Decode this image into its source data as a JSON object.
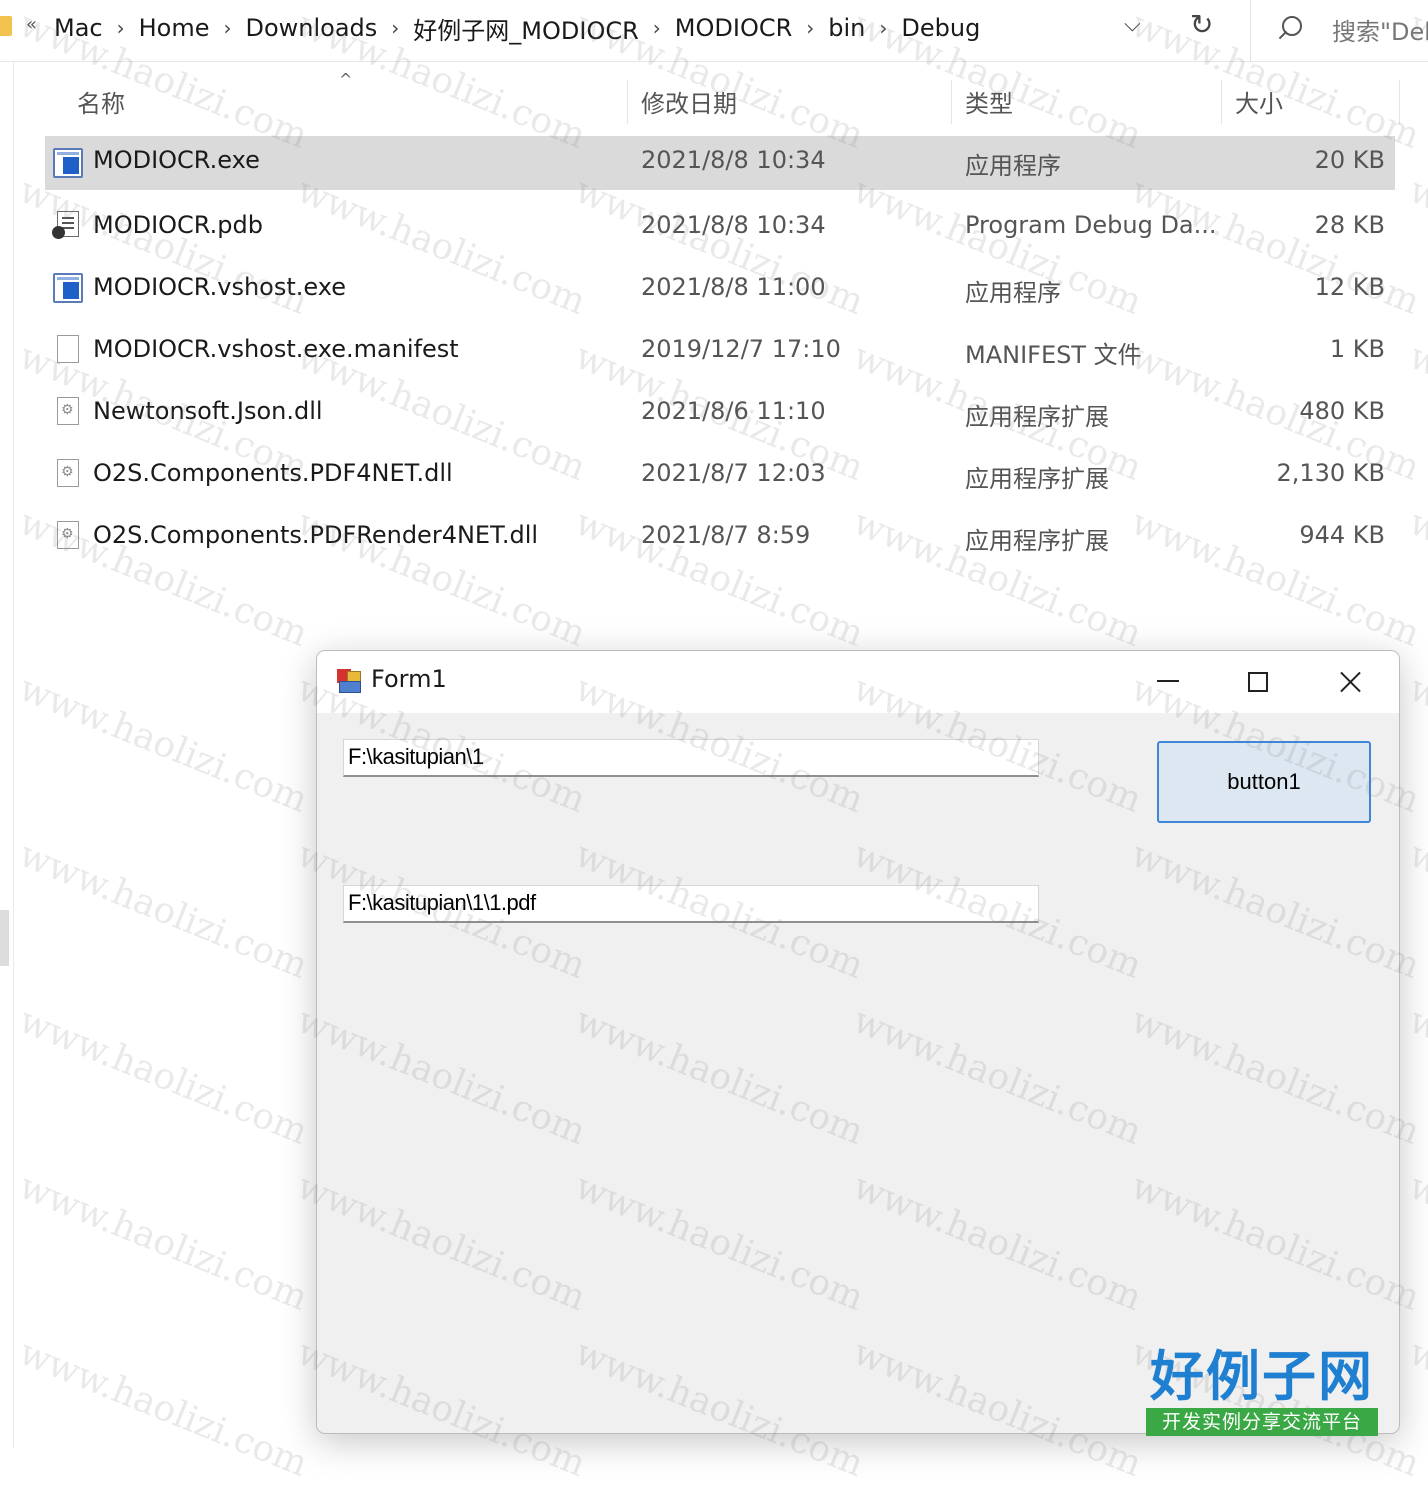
{
  "address_bar": {
    "overflow": "«",
    "crumbs": [
      "Mac",
      "Home",
      "Downloads",
      "好例子网_MODIOCR",
      "MODIOCR",
      "bin",
      "Debug"
    ],
    "separator": "›",
    "dropdown": "⌵",
    "refresh": "↻",
    "search_placeholder": "搜索\"Debug\""
  },
  "columns": {
    "name": "名称",
    "date": "修改日期",
    "type": "类型",
    "size": "大小",
    "sort_indicator": "^"
  },
  "files": [
    {
      "name": "MODIOCR.exe",
      "date": "2021/8/8 10:34",
      "type": "应用程序",
      "size": "20 KB",
      "icon": "exe-icon",
      "selected": true
    },
    {
      "name": "MODIOCR.pdb",
      "date": "2021/8/8 10:34",
      "type": "Program Debug Da...",
      "size": "28 KB",
      "icon": "pdb-icon",
      "selected": false
    },
    {
      "name": "MODIOCR.vshost.exe",
      "date": "2021/8/8 11:00",
      "type": "应用程序",
      "size": "12 KB",
      "icon": "exe-icon",
      "selected": false
    },
    {
      "name": "MODIOCR.vshost.exe.manifest",
      "date": "2019/12/7 17:10",
      "type": "MANIFEST 文件",
      "size": "1 KB",
      "icon": "file-icon",
      "selected": false
    },
    {
      "name": "Newtonsoft.Json.dll",
      "date": "2021/8/6 11:10",
      "type": "应用程序扩展",
      "size": "480 KB",
      "icon": "dll-icon",
      "selected": false
    },
    {
      "name": "O2S.Components.PDF4NET.dll",
      "date": "2021/8/7 12:03",
      "type": "应用程序扩展",
      "size": "2,130 KB",
      "icon": "dll-icon",
      "selected": false
    },
    {
      "name": "O2S.Components.PDFRender4NET.dll",
      "date": "2021/8/7 8:59",
      "type": "应用程序扩展",
      "size": "944 KB",
      "icon": "dll-icon",
      "selected": false
    }
  ],
  "form1": {
    "title": "Form1",
    "textbox1_value": "F:\\kasitupian\\1",
    "textbox2_value": "F:\\kasitupian\\1\\1.pdf",
    "button1_label": "button1"
  },
  "watermark": {
    "text": "www.haolizi.com",
    "brand_main": "好例子网",
    "brand_sub": "开发实例分享交流平台"
  },
  "colors": {
    "selected_row": "#dadada",
    "button_border": "#3f86d6",
    "button_bg": "#dde7f2",
    "brand_blue": "#1f7fd0",
    "brand_green": "#3aa845"
  }
}
